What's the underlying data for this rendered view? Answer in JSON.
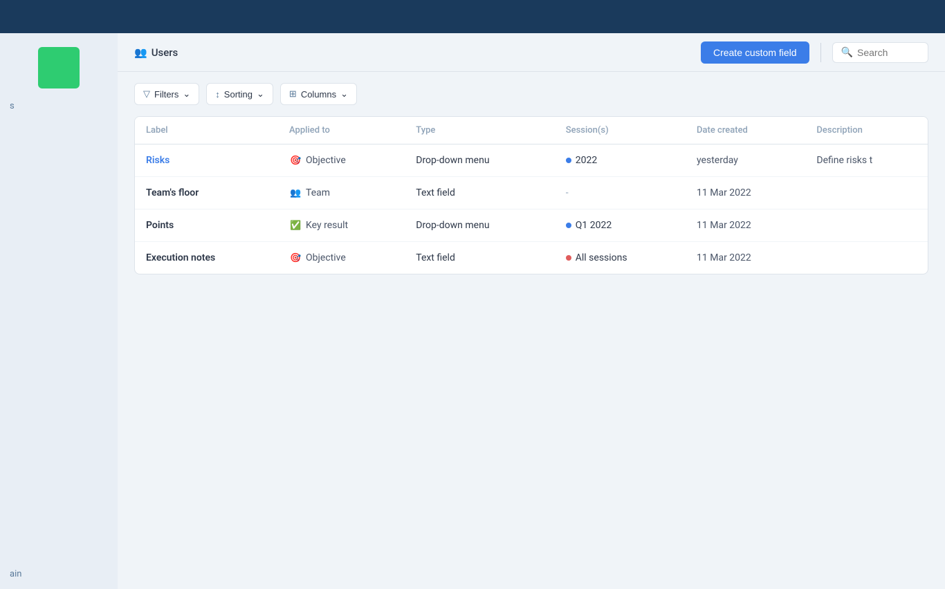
{
  "topBar": {},
  "header": {
    "usersIcon": "👥",
    "usersLabel": "Users",
    "createBtnLabel": "Create custom field",
    "searchPlaceholder": "Search"
  },
  "toolbar": {
    "filtersLabel": "Filters",
    "sortingLabel": "Sorting",
    "columnsLabel": "Columns"
  },
  "table": {
    "columns": [
      "Label",
      "Applied to",
      "Type",
      "Session(s)",
      "Date created",
      "Description"
    ],
    "rows": [
      {
        "label": "Risks",
        "labelType": "link",
        "appliedToIcon": "🎯",
        "appliedTo": "Objective",
        "type": "Drop-down menu",
        "sessionDot": "blue",
        "session": "2022",
        "dateCreated": "yesterday",
        "description": "Define risks t"
      },
      {
        "label": "Team's floor",
        "labelType": "bold",
        "appliedToIcon": "👥",
        "appliedTo": "Team",
        "type": "Text field",
        "sessionDot": "none",
        "session": "-",
        "dateCreated": "11 Mar 2022",
        "description": ""
      },
      {
        "label": "Points",
        "labelType": "bold",
        "appliedToIcon": "✅",
        "appliedTo": "Key result",
        "type": "Drop-down menu",
        "sessionDot": "blue",
        "session": "Q1 2022",
        "dateCreated": "11 Mar 2022",
        "description": ""
      },
      {
        "label": "Execution notes",
        "labelType": "bold",
        "appliedToIcon": "🎯",
        "appliedTo": "Objective",
        "type": "Text field",
        "sessionDot": "red",
        "session": "All sessions",
        "dateCreated": "11 Mar 2022",
        "description": ""
      }
    ]
  },
  "sidebar": {
    "itemLabel": "s",
    "bottomLabel": "ain"
  }
}
